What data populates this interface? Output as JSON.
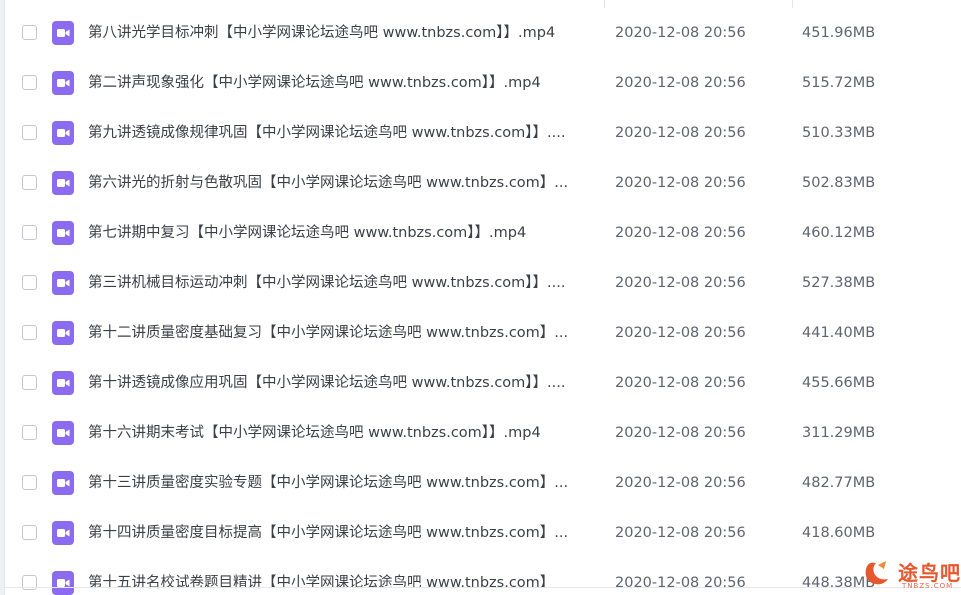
{
  "files": [
    {
      "name": "第八讲光学目标冲刺【中小学网课论坛途鸟吧 www.tnbzs.com】】.mp4",
      "date": "2020-12-08 20:56",
      "size": "451.96MB"
    },
    {
      "name": "第二讲声现象强化【中小学网课论坛途鸟吧 www.tnbzs.com】】.mp4",
      "date": "2020-12-08 20:56",
      "size": "515.72MB"
    },
    {
      "name": "第九讲透镜成像规律巩固【中小学网课论坛途鸟吧 www.tnbzs.com】】....",
      "date": "2020-12-08 20:56",
      "size": "510.33MB"
    },
    {
      "name": "第六讲光的折射与色散巩固【中小学网课论坛途鸟吧 www.tnbzs.com】...",
      "date": "2020-12-08 20:56",
      "size": "502.83MB"
    },
    {
      "name": "第七讲期中复习【中小学网课论坛途鸟吧 www.tnbzs.com】】.mp4",
      "date": "2020-12-08 20:56",
      "size": "460.12MB"
    },
    {
      "name": "第三讲机械目标运动冲刺【中小学网课论坛途鸟吧 www.tnbzs.com】】....",
      "date": "2020-12-08 20:56",
      "size": "527.38MB"
    },
    {
      "name": "第十二讲质量密度基础复习【中小学网课论坛途鸟吧 www.tnbzs.com】...",
      "date": "2020-12-08 20:56",
      "size": "441.40MB"
    },
    {
      "name": "第十讲透镜成像应用巩固【中小学网课论坛途鸟吧 www.tnbzs.com】】....",
      "date": "2020-12-08 20:56",
      "size": "455.66MB"
    },
    {
      "name": "第十六讲期末考试【中小学网课论坛途鸟吧 www.tnbzs.com】】.mp4",
      "date": "2020-12-08 20:56",
      "size": "311.29MB"
    },
    {
      "name": "第十三讲质量密度实验专题【中小学网课论坛途鸟吧 www.tnbzs.com】...",
      "date": "2020-12-08 20:56",
      "size": "482.77MB"
    },
    {
      "name": "第十四讲质量密度目标提高【中小学网课论坛途鸟吧 www.tnbzs.com】...",
      "date": "2020-12-08 20:56",
      "size": "418.60MB"
    },
    {
      "name": "第十五讲名校试卷题目精讲【中小学网课论坛途鸟吧 www.tnbzs.com】",
      "date": "2020-12-08 20:56",
      "size": "448.38MB"
    }
  ],
  "watermark": {
    "text": "途鸟吧",
    "sub": "TNBZS.COM"
  },
  "colors": {
    "accent_icon": "#8b6cf0",
    "watermark": "#e5572f"
  },
  "icons": {
    "file": "video-file-icon",
    "watermark": "tnbzs-logo-icon"
  }
}
